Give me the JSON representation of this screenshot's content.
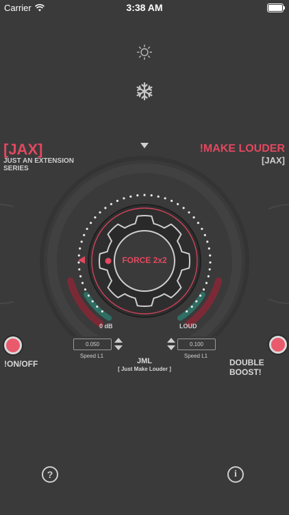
{
  "status_bar": {
    "carrier": "Carrier",
    "time": "3:38 AM"
  },
  "icons": {
    "top": "sun-icon",
    "second": "snowflake-icon",
    "indicator": "triangle-down-icon"
  },
  "brand_left": {
    "title": "[JAX]",
    "subtitle_line1": "JUST AN EXTENSION",
    "subtitle_line2": "SERIES"
  },
  "brand_right": {
    "title": "!MAKE LOUDER",
    "subtitle": "[JAX]"
  },
  "knob": {
    "label": "FORCE 2x2",
    "min_label": "0 dB",
    "max_label": "LOUD"
  },
  "left_control": {
    "value": "0.050",
    "label": "Speed L1"
  },
  "right_control": {
    "value": "0.100",
    "label": "Speed L1"
  },
  "center": {
    "title": "JML",
    "subtitle": "[ Just Make Louder ]"
  },
  "buttons": {
    "onoff": "!ON/OFF",
    "boost": "DOUBLE BOOST!",
    "help": "?",
    "info": "i"
  },
  "colors": {
    "accent": "#e2485f",
    "background": "#3a3a3b",
    "green": "#2f6e62"
  }
}
